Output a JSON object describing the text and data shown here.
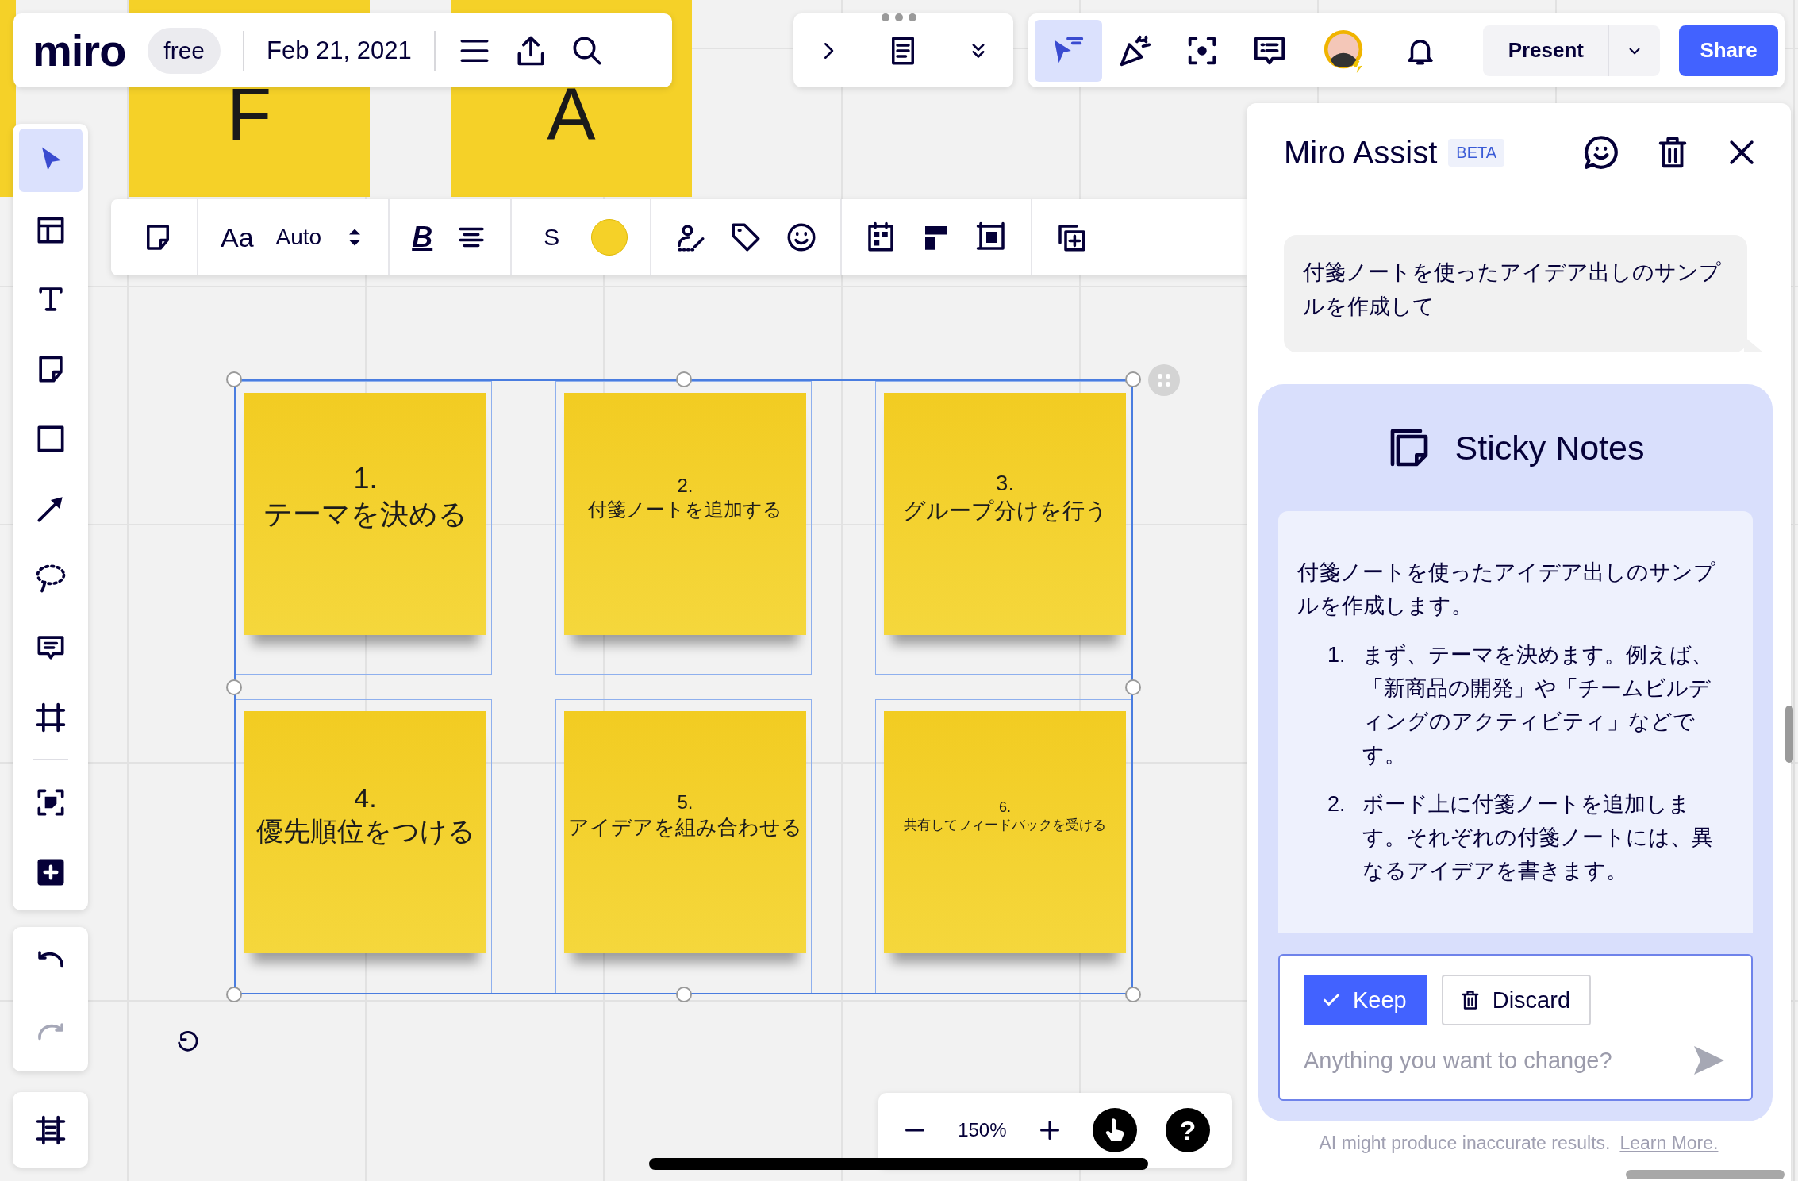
{
  "top_bar": {
    "logo": "miro",
    "plan": "free",
    "date": "Feb 21, 2021"
  },
  "top_right": {
    "select_active": true,
    "present": "Present",
    "share": "Share"
  },
  "left_toolbar": {
    "tools": [
      {
        "selected": true
      },
      {
        "selected": false
      },
      {
        "selected": false
      },
      {
        "selected": false
      },
      {
        "selected": false
      },
      {
        "selected": false
      },
      {
        "selected": false
      },
      {
        "selected": false
      },
      {
        "selected": false
      },
      {
        "selected": false
      },
      {
        "selected": false
      }
    ],
    "history": [
      {
        "disabled": false
      },
      {
        "disabled": true
      }
    ]
  },
  "background_stickies": [
    {
      "text": "F"
    },
    {
      "text": "A"
    }
  ],
  "context_toolbar": {
    "font_icon": "Aa",
    "font_size": "Auto",
    "bold": "B",
    "size": "S"
  },
  "selection": {
    "stickies": [
      {
        "number": "1.",
        "text": "テーマを決める"
      },
      {
        "number": "2.",
        "text": "付箋ノートを追加する"
      },
      {
        "number": "3.",
        "text": "グループ分けを行う"
      },
      {
        "number": "4.",
        "text": "優先順位をつける"
      },
      {
        "number": "5.",
        "text": "アイデアを組み合わせる"
      },
      {
        "number": "6.",
        "text": "共有してフィードバックを受ける"
      }
    ]
  },
  "zoom_bar": {
    "zoom": "150%",
    "help": "?"
  },
  "assist": {
    "title": "Miro Assist",
    "badge": "BETA",
    "user_message": "付箋ノートを使ったアイデア出しのサンプルを作成して",
    "card": {
      "title": "Sticky Notes",
      "intro": "付箋ノートを使ったアイデア出しのサンプルを作成します。",
      "steps": [
        {
          "number": "1.",
          "text": "まず、テーマを決めます。例えば、「新商品の開発」や「チームビルディングのアクティビティ」などです。"
        },
        {
          "number": "2.",
          "text": "ボード上に付箋ノートを追加します。それぞれの付箋ノートには、異なるアイデアを書きます。"
        }
      ]
    },
    "keep": "Keep",
    "discard": "Discard",
    "input": {
      "placeholder": "Anything you want to change?"
    },
    "footer": {
      "text": "AI might produce inaccurate results.",
      "link": "Learn More."
    }
  }
}
